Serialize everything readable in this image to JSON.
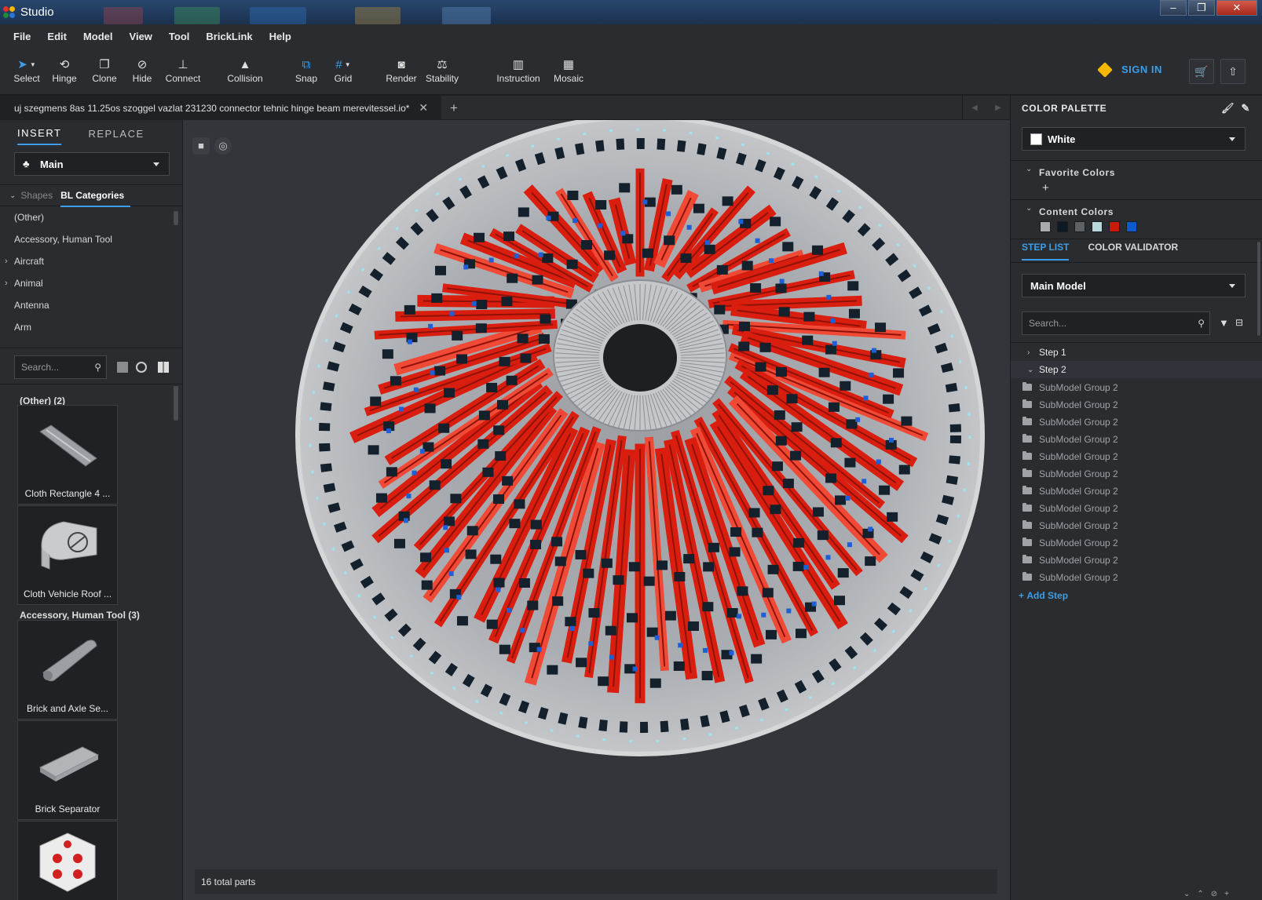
{
  "window": {
    "title": "Studio",
    "controls": [
      "–",
      "❐",
      "✕"
    ]
  },
  "menu": [
    "File",
    "Edit",
    "Model",
    "View",
    "Tool",
    "BrickLink",
    "Help"
  ],
  "toolbar": {
    "tools": [
      {
        "label": "Select",
        "icon": "select-arrow-icon"
      },
      {
        "label": "Hinge",
        "icon": "hinge-icon"
      },
      {
        "label": "Clone",
        "icon": "clone-icon"
      },
      {
        "label": "Hide",
        "icon": "hide-eye-icon"
      },
      {
        "label": "Connect",
        "icon": "connect-icon"
      },
      {
        "label": "Collision",
        "icon": "collision-warning-icon"
      },
      {
        "label": "Snap",
        "icon": "snap-icon"
      },
      {
        "label": "Grid",
        "icon": "grid-icon"
      },
      {
        "label": "Render",
        "icon": "camera-icon"
      },
      {
        "label": "Stability",
        "icon": "stability-icon"
      },
      {
        "label": "Instruction",
        "icon": "instruction-book-icon"
      },
      {
        "label": "Mosaic",
        "icon": "mosaic-icon"
      }
    ],
    "sign_in": "SIGN IN"
  },
  "document_tab": {
    "label": "uj szegmens 8as 11.25os szoggel vazlat 231230 connector tehnic hinge beam merevitessel.io*"
  },
  "left_panel": {
    "tabs": {
      "insert": "INSERT",
      "replace": "REPLACE"
    },
    "palette_select": "Main",
    "shapes_label": "Shapes",
    "bl_categories_label": "BL Categories",
    "categories": [
      {
        "label": "(Other)",
        "expandable": false
      },
      {
        "label": "Accessory, Human Tool",
        "expandable": false
      },
      {
        "label": "Aircraft",
        "expandable": true
      },
      {
        "label": "Animal",
        "expandable": true
      },
      {
        "label": "Antenna",
        "expandable": false
      },
      {
        "label": "Arm",
        "expandable": false
      }
    ],
    "search_placeholder": "Search...",
    "groups": [
      {
        "title": "(Other) (2)",
        "parts": [
          "Cloth Rectangle 4 ...",
          "Cloth Vehicle Roof ..."
        ]
      },
      {
        "title": "Accessory, Human Tool (3)",
        "parts": [
          "Brick and Axle Se...",
          "Brick Separator"
        ]
      }
    ]
  },
  "viewport": {
    "status": "16 total parts"
  },
  "right_panel": {
    "color_palette_title": "COLOR PALETTE",
    "selected_color": "White",
    "favorite_colors_label": "Favorite Colors",
    "content_colors_label": "Content Colors",
    "content_colors": [
      "#a9abad",
      "#0d1a24",
      "#5f6265",
      "#b9d8dc",
      "#c91a09",
      "#0d5bd1"
    ],
    "step_tabs": {
      "step_list": "STEP LIST",
      "color_validator": "COLOR VALIDATOR"
    },
    "model_select": "Main Model",
    "search_placeholder": "Search...",
    "steps": [
      "Step 1",
      "Step 2"
    ],
    "submodels": [
      "SubModel Group 2",
      "SubModel Group 2",
      "SubModel Group 2",
      "SubModel Group 2",
      "SubModel Group 2",
      "SubModel Group 2",
      "SubModel Group 2",
      "SubModel Group 2",
      "SubModel Group 2",
      "SubModel Group 2",
      "SubModel Group 2",
      "SubModel Group 2"
    ],
    "add_step": "Add Step"
  }
}
